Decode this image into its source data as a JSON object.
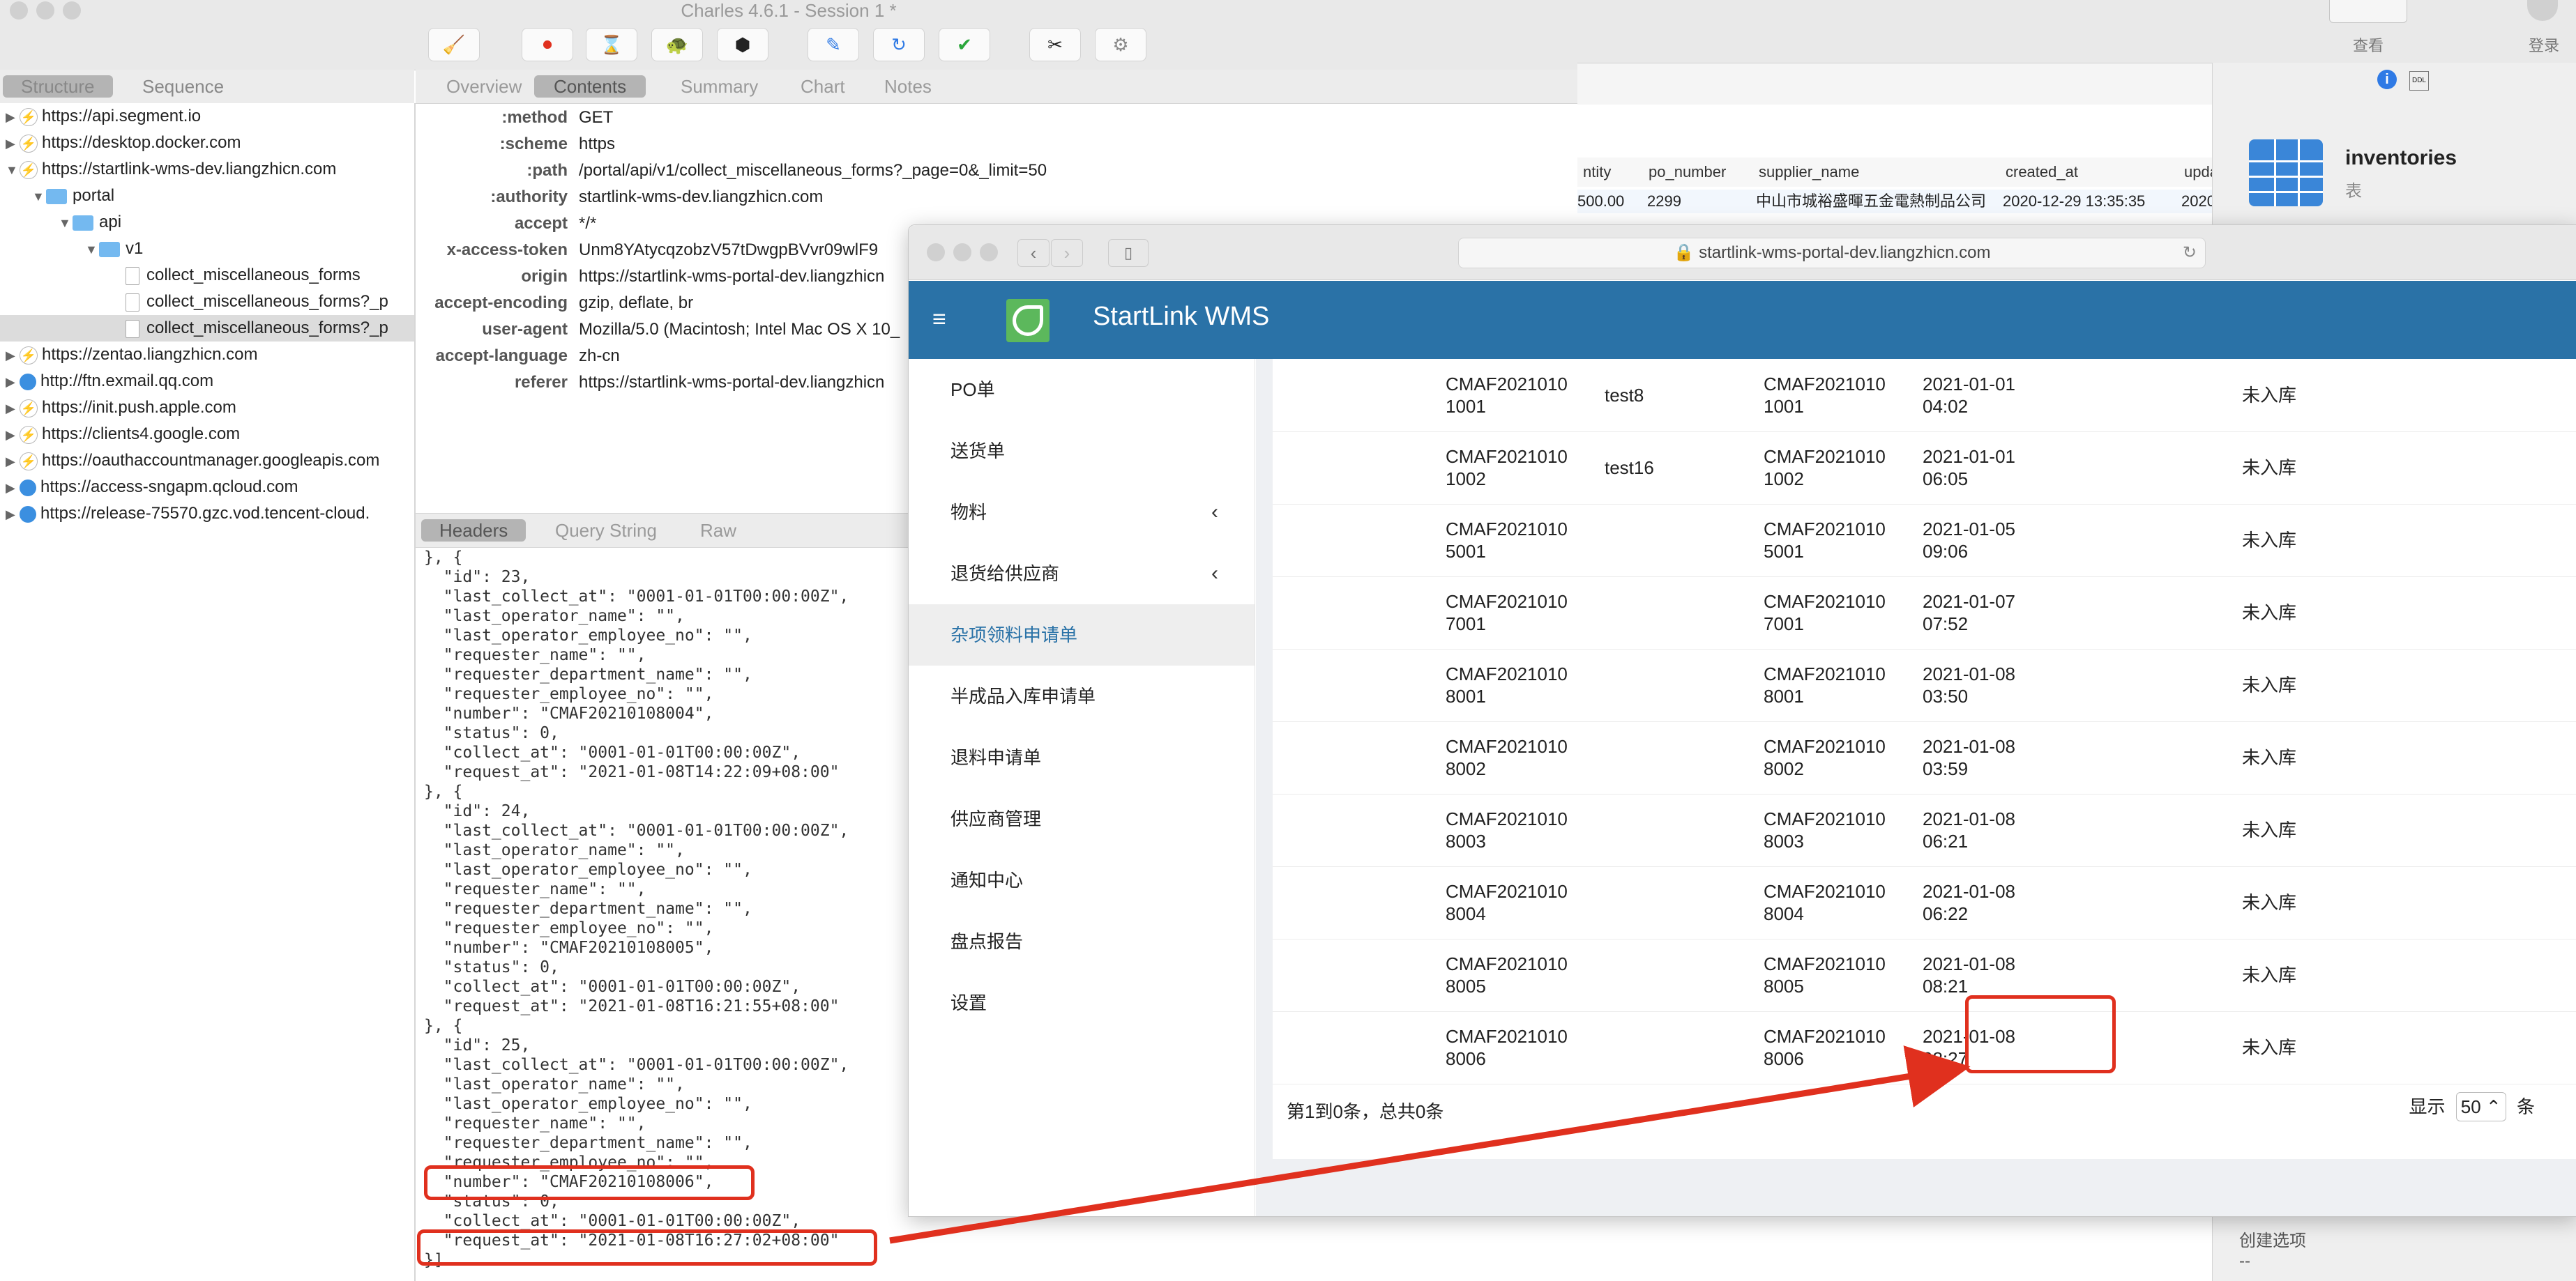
{
  "charles": {
    "title": "Charles 4.6.1 - Session 1 *",
    "left_tabs": [
      "Structure",
      "Sequence"
    ],
    "right_tabs": [
      "Overview",
      "Contents",
      "Summary",
      "Chart",
      "Notes"
    ],
    "tree": [
      {
        "label": "https://api.segment.io",
        "icon": "bolt-icon"
      },
      {
        "label": "https://desktop.docker.com",
        "icon": "bolt-icon"
      },
      {
        "label": "https://startlink-wms-dev.liangzhicn.com",
        "icon": "bolt-icon"
      },
      {
        "label": "portal",
        "icon": "folder-icon"
      },
      {
        "label": "api",
        "icon": "folder-icon"
      },
      {
        "label": "v1",
        "icon": "folder-icon"
      },
      {
        "label": "collect_miscellaneous_forms",
        "icon": "doc-icon"
      },
      {
        "label": "collect_miscellaneous_forms?_p",
        "icon": "doc-icon"
      },
      {
        "label": "collect_miscellaneous_forms?_p",
        "icon": "doc-icon"
      },
      {
        "label": "https://zentao.liangzhicn.com",
        "icon": "bolt-icon"
      },
      {
        "label": "http://ftn.exmail.qq.com",
        "icon": "globe-icon"
      },
      {
        "label": "https://init.push.apple.com",
        "icon": "bolt-icon"
      },
      {
        "label": "https://clients4.google.com",
        "icon": "bolt-icon"
      },
      {
        "label": "https://oauthaccountmanager.googleapis.com",
        "icon": "bolt-icon"
      },
      {
        "label": "https://access-sngapm.qcloud.com",
        "icon": "globe-icon"
      },
      {
        "label": "https://release-75570.gzc.vod.tencent-cloud.",
        "icon": "globe-icon"
      }
    ],
    "headers": [
      {
        "k": ":method",
        "v": "GET"
      },
      {
        "k": ":scheme",
        "v": "https"
      },
      {
        "k": ":path",
        "v": "/portal/api/v1/collect_miscellaneous_forms?_page=0&_limit=50"
      },
      {
        "k": ":authority",
        "v": "startlink-wms-dev.liangzhicn.com"
      },
      {
        "k": "accept",
        "v": "*/*"
      },
      {
        "k": "x-access-token",
        "v": "Unm8YAtycqzobzV57tDwgpBVvr09wlF9"
      },
      {
        "k": "origin",
        "v": "https://startlink-wms-portal-dev.liangzhicn"
      },
      {
        "k": "accept-encoding",
        "v": "gzip, deflate, br"
      },
      {
        "k": "user-agent",
        "v": "Mozilla/5.0 (Macintosh; Intel Mac OS X 10_"
      },
      {
        "k": "accept-language",
        "v": "zh-cn"
      },
      {
        "k": "referer",
        "v": "https://startlink-wms-portal-dev.liangzhicn"
      }
    ],
    "bottom_tabs": [
      "Headers",
      "Query String",
      "Raw"
    ],
    "json_lines": [
      "}, {",
      "  \"id\": 23,",
      "  \"last_collect_at\": \"0001-01-01T00:00:00Z\",",
      "  \"last_operator_name\": \"\",",
      "  \"last_operator_employee_no\": \"\",",
      "  \"requester_name\": \"\",",
      "  \"requester_department_name\": \"\",",
      "  \"requester_employee_no\": \"\",",
      "  \"number\": \"CMAF20210108004\",",
      "  \"status\": 0,",
      "  \"collect_at\": \"0001-01-01T00:00:00Z\",",
      "  \"request_at\": \"2021-01-08T14:22:09+08:00\"",
      "}, {",
      "  \"id\": 24,",
      "  \"last_collect_at\": \"0001-01-01T00:00:00Z\",",
      "  \"last_operator_name\": \"\",",
      "  \"last_operator_employee_no\": \"\",",
      "  \"requester_name\": \"\",",
      "  \"requester_department_name\": \"\",",
      "  \"requester_employee_no\": \"\",",
      "  \"number\": \"CMAF20210108005\",",
      "  \"status\": 0,",
      "  \"collect_at\": \"0001-01-01T00:00:00Z\",",
      "  \"request_at\": \"2021-01-08T16:21:55+08:00\"",
      "}, {",
      "  \"id\": 25,",
      "  \"last_collect_at\": \"0001-01-01T00:00:00Z\",",
      "  \"last_operator_name\": \"\",",
      "  \"last_operator_employee_no\": \"\",",
      "  \"requester_name\": \"\",",
      "  \"requester_department_name\": \"\",",
      "  \"requester_employee_no\": \"\",",
      "  \"number\": \"CMAF20210108006\",",
      "  \"status\": 0,",
      "  \"collect_at\": \"0001-01-01T00:00:00Z\",",
      "  \"request_at\": \"2021-01-08T16:27:02+08:00\"",
      "}]"
    ]
  },
  "db": {
    "columns": [
      "ntity",
      "po_number",
      "supplier_name",
      "created_at",
      "updat"
    ],
    "row1": [
      "500.00",
      "2299",
      "中山市城裕盛暉五金電熱制品公司",
      "2020-12-29 13:35:35",
      "2020"
    ],
    "toolbar": [
      "查看",
      "登录"
    ],
    "panel_title": "inventories",
    "panel_sub": "表",
    "panel_bottom": "创建选项",
    "panel_bottom_val": "--"
  },
  "browser": {
    "url": "startlink-wms-portal-dev.liangzhicn.com",
    "app_title": "StartLink WMS",
    "menu": [
      {
        "label": "PO单",
        "chev": false
      },
      {
        "label": "送货单",
        "chev": false
      },
      {
        "label": "物料",
        "chev": true
      },
      {
        "label": "退货给供应商",
        "chev": true
      },
      {
        "label": "杂项领料申请单",
        "chev": false,
        "active": true
      },
      {
        "label": "半成品入库申请单",
        "chev": false
      },
      {
        "label": "退料申请单",
        "chev": false
      },
      {
        "label": "供应商管理",
        "chev": false
      },
      {
        "label": "通知中心",
        "chev": false
      },
      {
        "label": "盘点报告",
        "chev": false
      },
      {
        "label": "设置",
        "chev": false
      }
    ],
    "rows": [
      {
        "no": "CMAF2021010\n1001",
        "name": "test8",
        "no2": "CMAF2021010\n1001",
        "date": "2021-01-01\n04:02",
        "status": "未入库"
      },
      {
        "no": "CMAF2021010\n1002",
        "name": "test16",
        "no2": "CMAF2021010\n1002",
        "date": "2021-01-01\n06:05",
        "status": "未入库"
      },
      {
        "no": "CMAF2021010\n5001",
        "name": "",
        "no2": "CMAF2021010\n5001",
        "date": "2021-01-05\n09:06",
        "status": "未入库"
      },
      {
        "no": "CMAF2021010\n7001",
        "name": "",
        "no2": "CMAF2021010\n7001",
        "date": "2021-01-07\n07:52",
        "status": "未入库"
      },
      {
        "no": "CMAF2021010\n8001",
        "name": "",
        "no2": "CMAF2021010\n8001",
        "date": "2021-01-08\n03:50",
        "status": "未入库"
      },
      {
        "no": "CMAF2021010\n8002",
        "name": "",
        "no2": "CMAF2021010\n8002",
        "date": "2021-01-08\n03:59",
        "status": "未入库"
      },
      {
        "no": "CMAF2021010\n8003",
        "name": "",
        "no2": "CMAF2021010\n8003",
        "date": "2021-01-08\n06:21",
        "status": "未入库"
      },
      {
        "no": "CMAF2021010\n8004",
        "name": "",
        "no2": "CMAF2021010\n8004",
        "date": "2021-01-08\n06:22",
        "status": "未入库"
      },
      {
        "no": "CMAF2021010\n8005",
        "name": "",
        "no2": "CMAF2021010\n8005",
        "date": "2021-01-08\n08:21",
        "status": "未入库"
      },
      {
        "no": "CMAF2021010\n8006",
        "name": "",
        "no2": "CMAF2021010\n8006",
        "date": "2021-01-08\n08:27",
        "status": "未入库"
      }
    ],
    "footer_left": "第1到0条，总共0条",
    "footer_show": "显示",
    "footer_page_size": "50 ⌃",
    "footer_unit": "条"
  },
  "annotation": {
    "color": "#e0301e"
  }
}
